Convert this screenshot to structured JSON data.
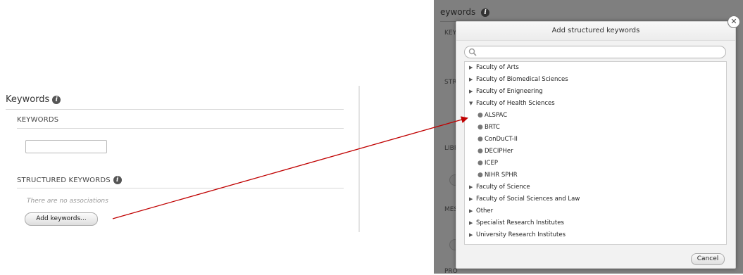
{
  "left": {
    "title": "Keywords",
    "keywords_heading": "KEYWORDS",
    "structured_heading": "STRUCTURED KEYWORDS",
    "no_assoc": "There are no associations",
    "add_button": "Add keywords..."
  },
  "background": {
    "title": "eywords",
    "frag_key": "KEY",
    "frag_str": "STR",
    "frag_str2": "STR",
    "frag_libr": "LIBR",
    "frag_mes": "MES",
    "frag_bottom": "PRO"
  },
  "dialog": {
    "title": "Add structured keywords",
    "search_placeholder": "",
    "items": [
      {
        "label": "Faculty of Arts"
      },
      {
        "label": "Faculty of Biomedical Sciences"
      },
      {
        "label": "Faculty of Enigneering"
      },
      {
        "label": "Faculty of Health Sciences"
      },
      {
        "label": "ALSPAC"
      },
      {
        "label": "BRTC"
      },
      {
        "label": "ConDuCT-II"
      },
      {
        "label": "DECIPHer"
      },
      {
        "label": "ICEP"
      },
      {
        "label": "NIHR SPHR"
      },
      {
        "label": "Faculty of Science"
      },
      {
        "label": "Faculty of Social Sciences and Law"
      },
      {
        "label": "Other"
      },
      {
        "label": "Specialist Research Institutes"
      },
      {
        "label": "University Research Institutes"
      }
    ],
    "cancel": "Cancel"
  },
  "colors": {
    "arrow": "#c00000",
    "overlay": "#7f7f7f"
  },
  "icons": {
    "info": "info-icon",
    "close": "close-icon",
    "search": "search-icon"
  }
}
